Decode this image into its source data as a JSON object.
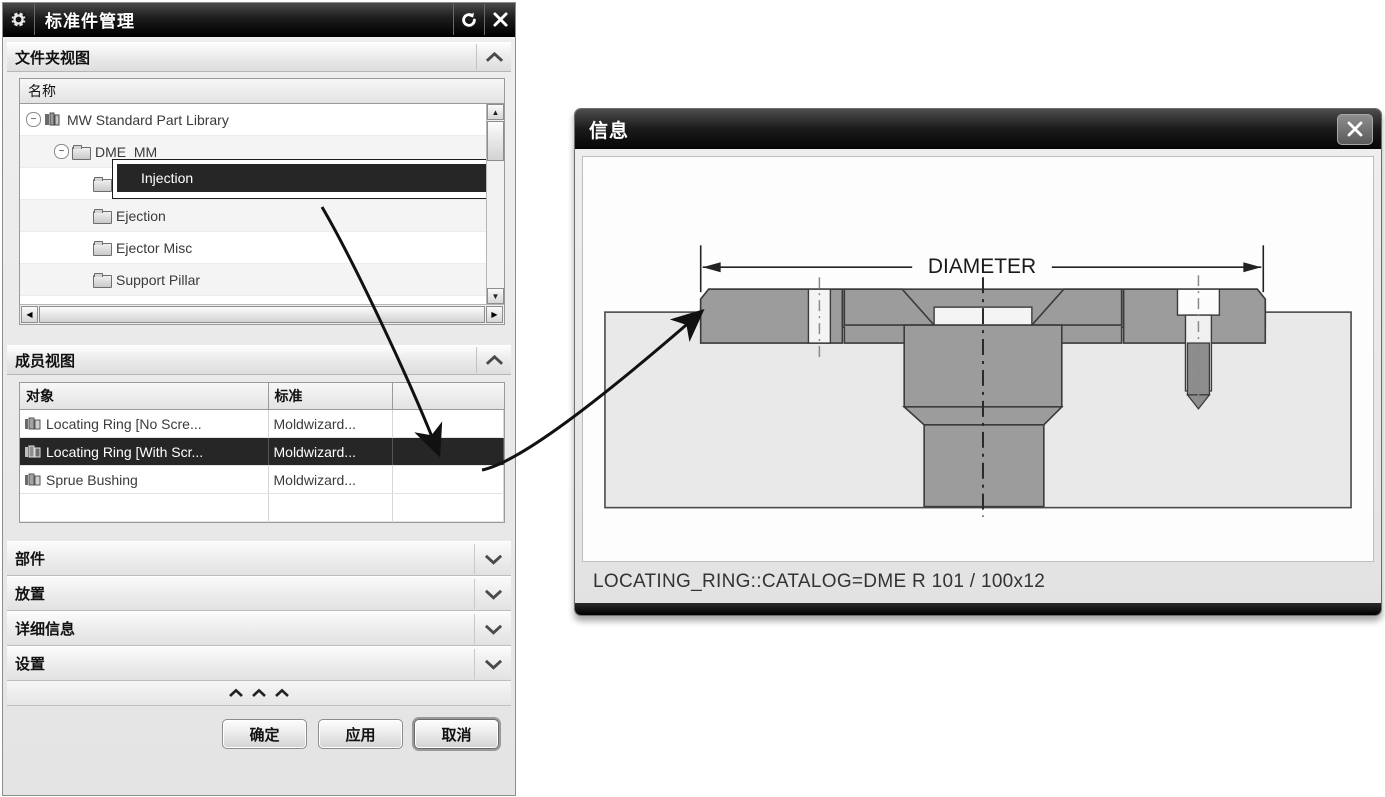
{
  "std_dialog": {
    "title": "标准件管理",
    "icons": {
      "gear": "gear-icon",
      "reset": "reset-icon",
      "close": "close-icon"
    },
    "folder_view": {
      "header": "文件夹视图",
      "column_header": "名称",
      "nodes": [
        {
          "label": "MW Standard Part Library",
          "depth": 0,
          "expander": "−",
          "icon": "library-icon",
          "selected": false
        },
        {
          "label": "DME_MM",
          "depth": 1,
          "expander": "−",
          "icon": "folder-icon",
          "selected": false
        },
        {
          "label": "Injection",
          "depth": 2,
          "expander": "",
          "icon": "folder-icon",
          "selected": true
        },
        {
          "label": "Ejection",
          "depth": 2,
          "expander": "",
          "icon": "folder-icon",
          "selected": false
        },
        {
          "label": "Ejector Misc",
          "depth": 2,
          "expander": "",
          "icon": "folder-icon",
          "selected": false
        },
        {
          "label": "Support Pillar",
          "depth": 2,
          "expander": "",
          "icon": "folder-icon",
          "selected": false
        }
      ]
    },
    "member_view": {
      "header": "成员视图",
      "columns": [
        "对象",
        "标准",
        ""
      ],
      "rows": [
        {
          "object": "Locating Ring [No Scre...",
          "standard": "Moldwizard...",
          "extra": "",
          "selected": false
        },
        {
          "object": "Locating Ring [With Scr...",
          "standard": "Moldwizard...",
          "extra": "",
          "selected": true
        },
        {
          "object": "Sprue Bushing",
          "standard": "Moldwizard...",
          "extra": "",
          "selected": false
        },
        {
          "object": "",
          "standard": "",
          "extra": "",
          "selected": false
        }
      ]
    },
    "collapsed_sections": [
      {
        "label": "部件"
      },
      {
        "label": "放置"
      },
      {
        "label": "详细信息"
      },
      {
        "label": "设置"
      }
    ],
    "collapse_all": "^ ^ ^",
    "buttons": [
      {
        "label": "确定",
        "focused": false
      },
      {
        "label": "应用",
        "focused": false
      },
      {
        "label": "取消",
        "focused": true
      }
    ]
  },
  "info_dialog": {
    "title": "信息",
    "close_icon": "close-icon",
    "drawing": {
      "dimension_label": "DIAMETER"
    },
    "caption": "LOCATING_RING::CATALOG=DME R 101  / 100x12"
  },
  "annotations": {
    "arrow_tree_to_row": "curved-arrow-icon",
    "arrow_row_to_drawing": "curved-arrow-icon"
  }
}
